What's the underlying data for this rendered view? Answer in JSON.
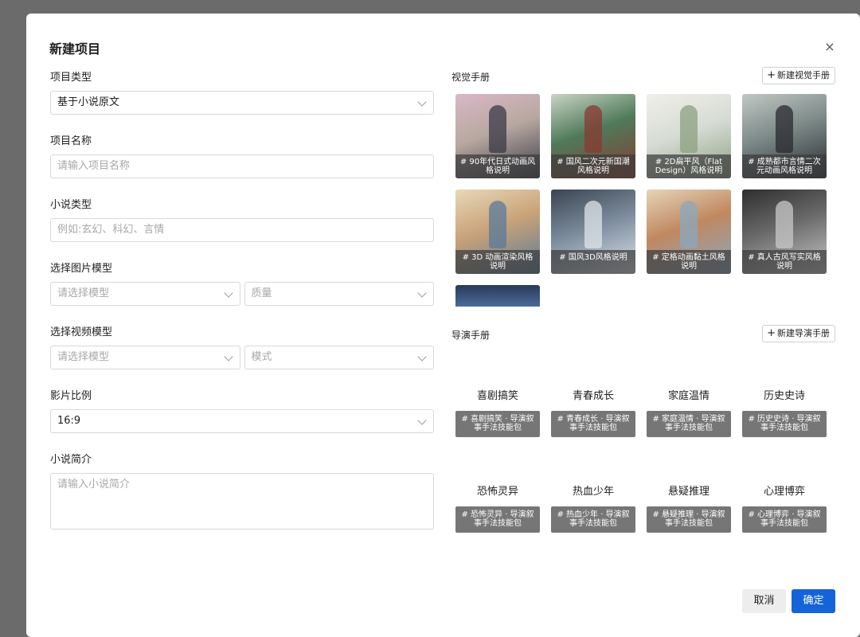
{
  "modal": {
    "title": "新建项目",
    "close_icon": "×"
  },
  "form": {
    "project_type": {
      "label": "项目类型",
      "value": "基于小说原文"
    },
    "project_name": {
      "label": "项目名称",
      "placeholder": "请输入项目名称"
    },
    "novel_type": {
      "label": "小说类型",
      "placeholder": "例如:玄幻、科幻、言情"
    },
    "image_model": {
      "label": "选择图片模型",
      "model_placeholder": "请选择模型",
      "quality_placeholder": "质量"
    },
    "video_model": {
      "label": "选择视频模型",
      "model_placeholder": "请选择模型",
      "mode_placeholder": "模式"
    },
    "aspect_ratio": {
      "label": "影片比例",
      "value": "16:9"
    },
    "synopsis": {
      "label": "小说简介",
      "placeholder": "请输入小说简介"
    }
  },
  "visual_manual": {
    "title": "视觉手册",
    "new_button": "新建视觉手册",
    "cards": [
      {
        "caption": "# 90年代日式动画风格说明",
        "colors": [
          "#b8a8a0",
          "#3a3a48",
          "#d9b8c8"
        ]
      },
      {
        "caption": "# 国风二次元新国潮风格说明",
        "colors": [
          "#4f7a5a",
          "#8a3a30",
          "#c9d4c4"
        ]
      },
      {
        "caption": "# 2D扁平风（Flat Design）风格说明",
        "colors": [
          "#d8dcd6",
          "#8ca080",
          "#f0efe8"
        ]
      },
      {
        "caption": "# 成熟都市言情二次元动画风格说明",
        "colors": [
          "#7c8a88",
          "#2a2a30",
          "#c2c8c4"
        ]
      },
      {
        "caption": "# 3D 动画渲染风格说明",
        "colors": [
          "#c8a278",
          "#5a7a9a",
          "#e8d8b8"
        ]
      },
      {
        "caption": "# 国风3D风格说明",
        "colors": [
          "#7a8a9a",
          "#dfe4ea",
          "#3a4450"
        ]
      },
      {
        "caption": "# 定格动画黏土风格说明",
        "colors": [
          "#c08860",
          "#8aa8c0",
          "#e6d4b8"
        ]
      },
      {
        "caption": "# 真人古风写实风格说明",
        "colors": [
          "#6a6a6a",
          "#c8c8c8",
          "#2e2e2e"
        ]
      }
    ]
  },
  "director_manual": {
    "title": "导演手册",
    "new_button": "新建导演手册",
    "cards": [
      {
        "title": "喜剧搞笑",
        "badge": "# 喜剧搞笑 · 导演叙事手法技能包"
      },
      {
        "title": "青春成长",
        "badge": "# 青春成长 · 导演叙事手法技能包"
      },
      {
        "title": "家庭温情",
        "badge": "# 家庭温情 · 导演叙事手法技能包"
      },
      {
        "title": "历史史诗",
        "badge": "# 历史史诗 · 导演叙事手法技能包"
      },
      {
        "title": "恐怖灵异",
        "badge": "# 恐怖灵异 · 导演叙事手法技能包"
      },
      {
        "title": "热血少年",
        "badge": "# 热血少年 · 导演叙事手法技能包"
      },
      {
        "title": "悬疑推理",
        "badge": "# 悬疑推理 · 导演叙事手法技能包"
      },
      {
        "title": "心理博弈",
        "badge": "# 心理博弈 · 导演叙事手法技能包"
      }
    ]
  },
  "footer": {
    "cancel": "取消",
    "confirm": "确定"
  },
  "colors": {
    "primary": "#1463d8",
    "overlay": "#6b6b6b",
    "badge": "#767676"
  }
}
